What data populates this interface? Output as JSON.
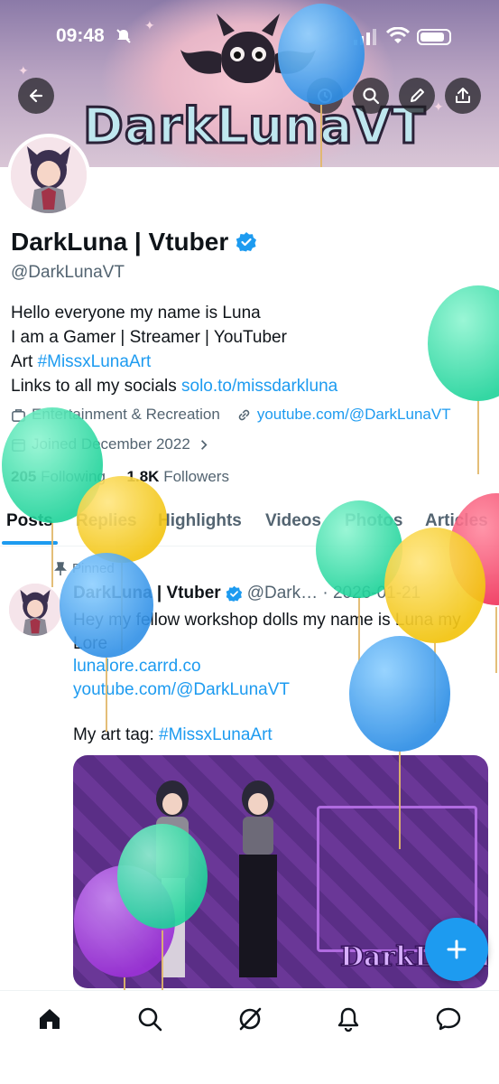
{
  "status_bar": {
    "time": "09:48"
  },
  "banner": {
    "title": "DarkLunaVT"
  },
  "profile": {
    "name": "DarkLuna | Vtuber",
    "handle": "@DarkLunaVT",
    "bio": {
      "line1": "Hello everyone my name is Luna",
      "line2": "I am a Gamer | Streamer | YouTuber",
      "line3_prefix": "Art ",
      "line3_link": "#MissxLunaArt",
      "line4_prefix": "Links to all my socials ",
      "line4_link": "solo.to/missdarkluna"
    },
    "category": "Entertainment & Recreation",
    "website": "youtube.com/@DarkLunaVT",
    "joined": "Joined December 2022",
    "following_count": "205",
    "following_label": "Following",
    "followers_count": "1.8K",
    "followers_label": "Followers"
  },
  "tabs": [
    "Posts",
    "Replies",
    "Highlights",
    "Videos",
    "Photos",
    "Articles"
  ],
  "post": {
    "pinned_label": "Pinned",
    "author_name": "DarkLuna | Vtuber",
    "author_handle_date": "@Dark… · 2026-01-21",
    "body_line1": "Hey my fellow workshop dolls my name is Luna my",
    "body_line2": "Lore",
    "link1": "lunalore.carrd.co",
    "link2": "youtube.com/@DarkLunaVT",
    "art_tag_prefix": "My art tag: ",
    "art_tag_link": "#MissxLunaArt",
    "image_logo": "DarkLuna"
  },
  "icons": {
    "back": "back-arrow-icon",
    "history": "history-icon",
    "search": "search-icon",
    "edit": "pencil-icon",
    "share": "share-icon",
    "verified": "verified-badge-icon"
  },
  "colors": {
    "accent": "#1d9bf0",
    "text": "#0f1419",
    "muted": "#536471"
  }
}
